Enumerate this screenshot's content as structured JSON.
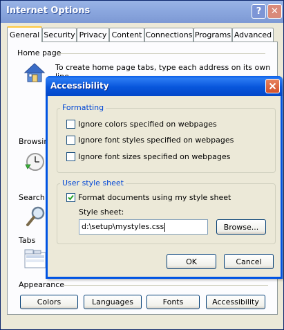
{
  "window": {
    "title": "Internet Options",
    "help_glyph": "?",
    "close_glyph": "✕"
  },
  "tabs": [
    {
      "label": "General",
      "active": true
    },
    {
      "label": "Security",
      "active": false
    },
    {
      "label": "Privacy",
      "active": false
    },
    {
      "label": "Content",
      "active": false
    },
    {
      "label": "Connections",
      "active": false
    },
    {
      "label": "Programs",
      "active": false
    },
    {
      "label": "Advanced",
      "active": false
    }
  ],
  "general": {
    "home_page": {
      "label": "Home page",
      "description": "To create home page tabs, type each address on its own line."
    },
    "browsing_label": "Browsing",
    "search_label": "Search",
    "tabs_label": "Tabs",
    "appearance": {
      "label": "Appearance",
      "buttons": [
        "Colors",
        "Languages",
        "Fonts",
        "Accessibility"
      ]
    }
  },
  "dialog": {
    "title": "Accessibility",
    "formatting": {
      "legend": "Formatting",
      "options": [
        {
          "label": "Ignore colors specified on webpages",
          "checked": false
        },
        {
          "label": "Ignore font styles specified on webpages",
          "checked": false
        },
        {
          "label": "Ignore font sizes specified on webpages",
          "checked": false
        }
      ]
    },
    "user_style_sheet": {
      "legend": "User style sheet",
      "format_option": {
        "label": "Format documents using my style sheet",
        "checked": true
      },
      "style_sheet_label": "Style sheet:",
      "style_sheet_value": "d:\\setup\\mystyles.css",
      "browse_label": "Browse..."
    },
    "ok_label": "OK",
    "cancel_label": "Cancel"
  },
  "colors": {
    "title_blue": "#0054e3",
    "legend_blue": "#0046d5",
    "dialog_bg": "#ece9d8"
  }
}
